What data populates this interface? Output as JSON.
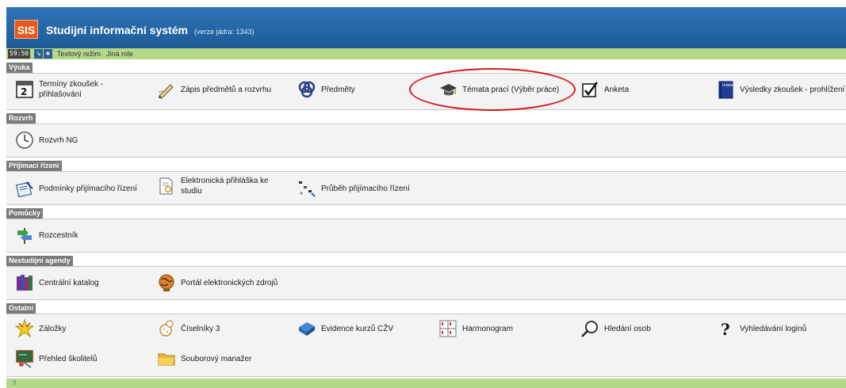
{
  "header": {
    "logo": "SIS",
    "title": "Studijní informační systém",
    "version": "(verze jádra: 1343)"
  },
  "toolbar": {
    "timer": "59:50",
    "arrow_glyph": "↘",
    "star_glyph": "★",
    "text_mode": "Textový režim",
    "other_role": "Jiná role"
  },
  "sections": {
    "vyuka": {
      "title": "Výuka",
      "items": [
        {
          "label": "Termíny zkoušek - přihlašování",
          "icon": "calendar-icon"
        },
        {
          "label": "Zápis předmětů a rozvrhu",
          "icon": "pencil-icon"
        },
        {
          "label": "Předměty",
          "icon": "knot-icon"
        },
        {
          "label": "Témata prací (Výběr práce)",
          "icon": "graduation-cap-icon"
        },
        {
          "label": "Anketa",
          "icon": "checkbox-icon"
        },
        {
          "label": "Výsledky zkoušek - prohlížení",
          "icon": "index-book-icon"
        }
      ]
    },
    "rozvrh": {
      "title": "Rozvrh",
      "items": [
        {
          "label": "Rozvrh NG",
          "icon": "clock-icon"
        }
      ]
    },
    "prijimaci": {
      "title": "Přijímací řízení",
      "items": [
        {
          "label": "Podmínky přijímacího řízení",
          "icon": "notepad-pen-icon"
        },
        {
          "label": "Elektronická přihláška ke studiu",
          "icon": "document-search-icon"
        },
        {
          "label": "Průběh přijímacího řízení",
          "icon": "path-icon"
        }
      ]
    },
    "pomucky": {
      "title": "Pomůcky",
      "items": [
        {
          "label": "Rozcestník",
          "icon": "signpost-icon"
        }
      ]
    },
    "nestudijni": {
      "title": "Nestudijní agendy",
      "items": [
        {
          "label": "Centrální katalog",
          "icon": "books-icon"
        },
        {
          "label": "Portál elektronických zdrojů",
          "icon": "globe-icon"
        }
      ]
    },
    "ostatni": {
      "title": "Ostatní",
      "items": [
        {
          "label": "Záložky",
          "icon": "star-burst-icon"
        },
        {
          "label": "Číselníky 3",
          "icon": "dice-icon"
        },
        {
          "label": "Evidence kurzů CŽV",
          "icon": "blue-book-icon"
        },
        {
          "label": "Harmonogram",
          "icon": "schedule-grid-icon"
        },
        {
          "label": "Hledání osob",
          "icon": "magnifier-icon"
        },
        {
          "label": "Vyhledávání loginů",
          "icon": "question-mark-icon"
        },
        {
          "label": "Přehled školitelů",
          "icon": "teacher-board-icon"
        },
        {
          "label": "Souborový manažer",
          "icon": "folder-icon"
        }
      ]
    }
  },
  "colors": {
    "header_blue": "#1d5b98",
    "toolbar_green": "#b5d789",
    "section_tab": "#7a7a7a",
    "highlight_red": "#d31a1a",
    "logo_orange": "#e8591c"
  }
}
